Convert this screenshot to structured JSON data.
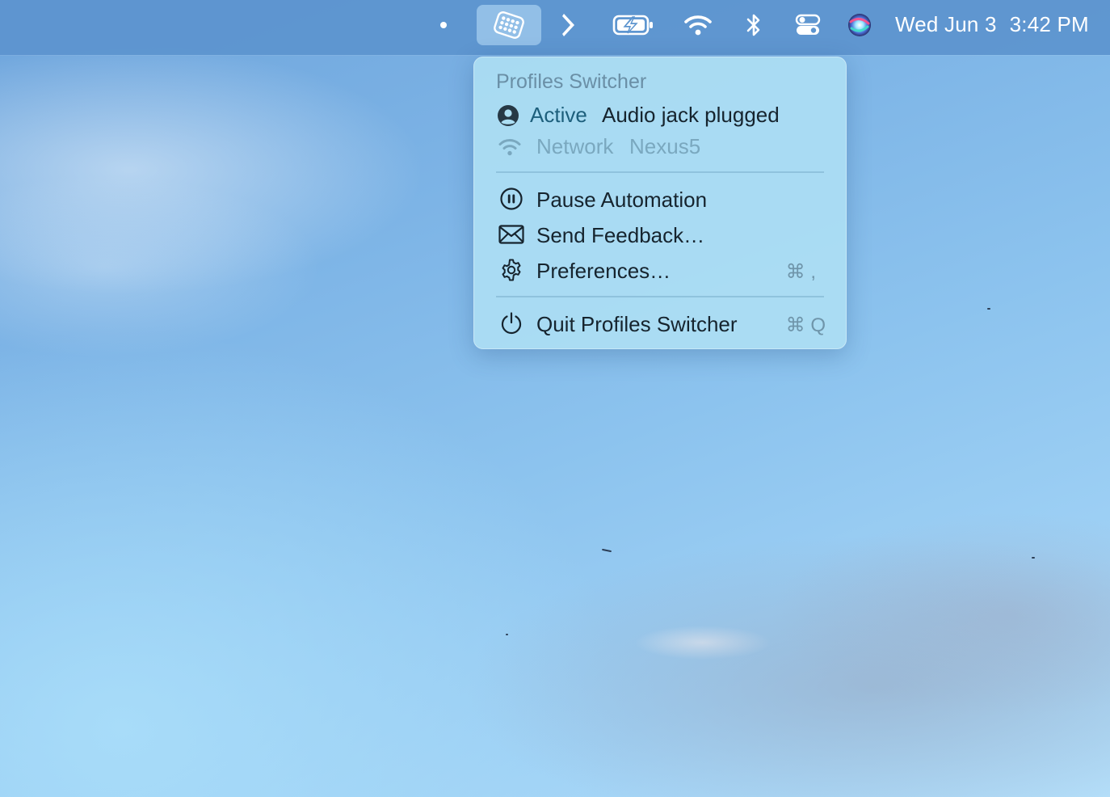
{
  "menubar": {
    "items": [
      {
        "name": "dot-indicator",
        "icon": "dot-icon"
      },
      {
        "name": "profiles-switcher-app",
        "icon": "waffle-icon",
        "active": true
      },
      {
        "name": "chevron-app",
        "icon": "chevron-right-icon"
      },
      {
        "name": "battery",
        "icon": "battery-charging-icon"
      },
      {
        "name": "wifi",
        "icon": "wifi-icon"
      },
      {
        "name": "bluetooth",
        "icon": "bluetooth-icon"
      },
      {
        "name": "control-center",
        "icon": "control-center-icon"
      },
      {
        "name": "siri",
        "icon": "siri-icon"
      }
    ],
    "date": "Wed Jun 3",
    "time": "3:42 PM"
  },
  "menu": {
    "title": "Profiles Switcher",
    "status": [
      {
        "key": "Active",
        "value": "Audio jack plugged",
        "icon": "user-circle-icon",
        "dimmed": false
      },
      {
        "key": "Network",
        "value": "Nexus5",
        "icon": "wifi-icon",
        "dimmed": true
      }
    ],
    "actions": [
      {
        "label": "Pause Automation",
        "icon": "pause-circle-icon",
        "shortcut": ""
      },
      {
        "label": "Send Feedback…",
        "icon": "envelope-icon",
        "shortcut": ""
      },
      {
        "label": "Preferences…",
        "icon": "gear-icon",
        "shortcut": "⌘ ,"
      }
    ],
    "quit": {
      "label": "Quit Profiles Switcher",
      "icon": "power-icon",
      "shortcut": "⌘ Q"
    }
  },
  "colors": {
    "menubar": "#5c94ce",
    "menu_background": "#acdef3",
    "menu_text": "#16242e",
    "status_key": "#1d5f7c",
    "dimmed_text": "#7aa8bf"
  }
}
